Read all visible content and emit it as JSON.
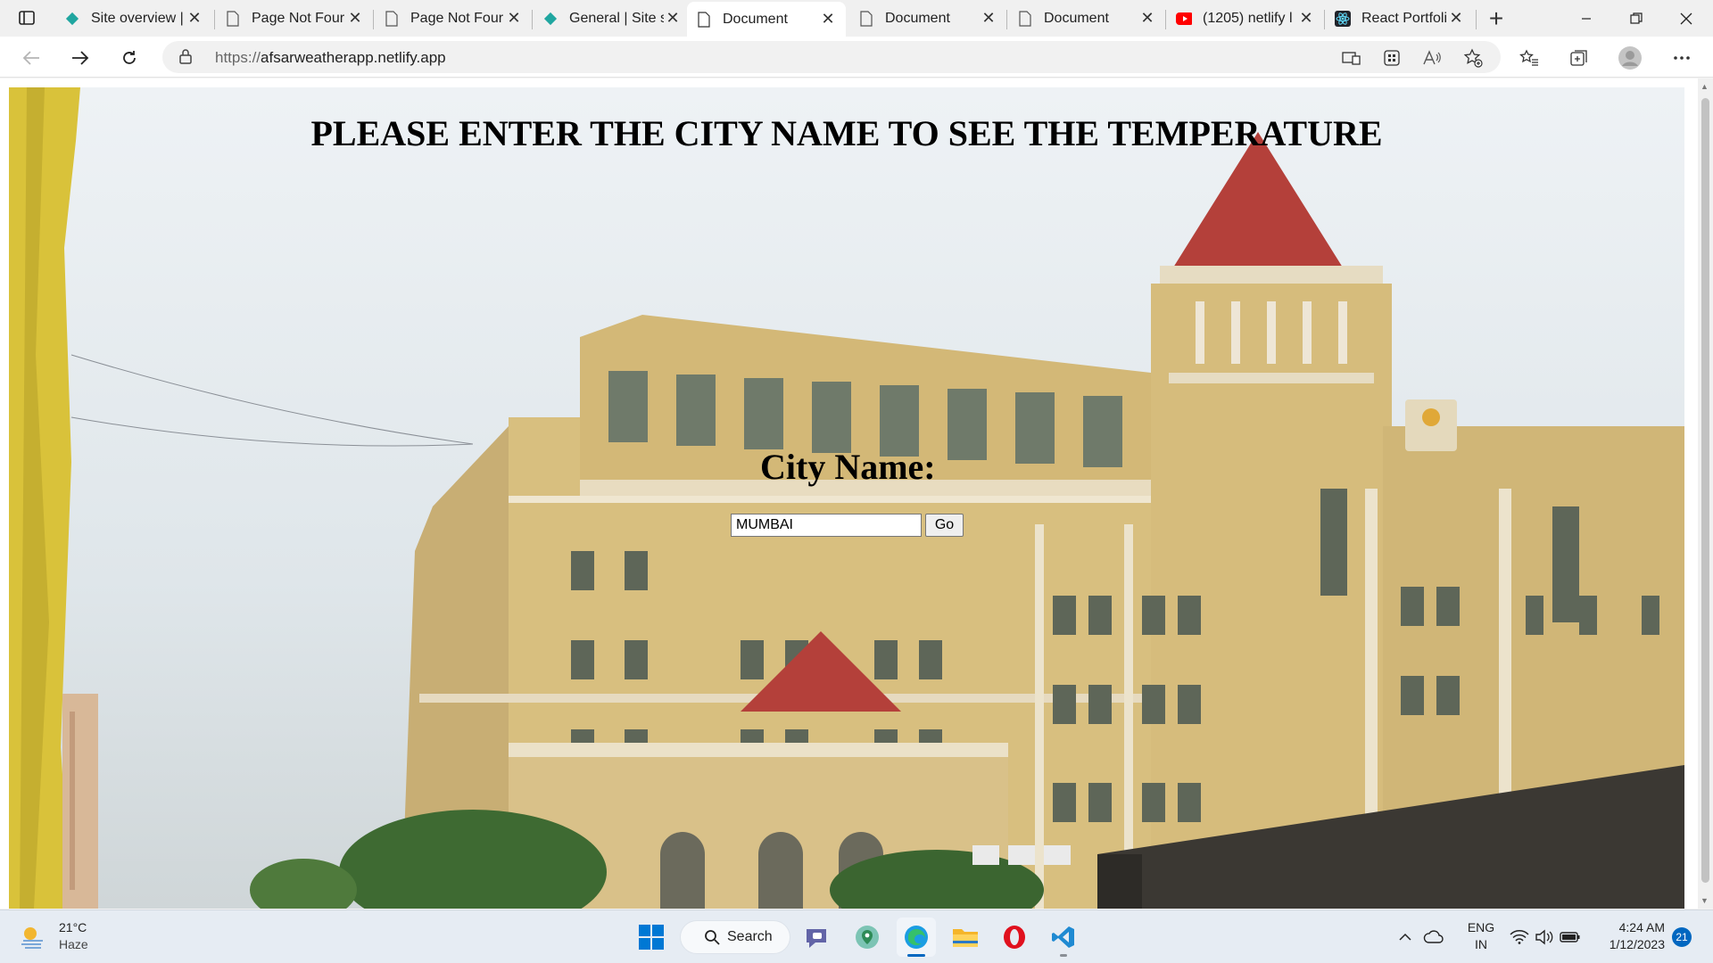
{
  "browser": {
    "tabs": [
      {
        "title": "Site overview |",
        "icon": "netlify-diamond-icon",
        "active": false
      },
      {
        "title": "Page Not Four",
        "icon": "page-icon",
        "active": false
      },
      {
        "title": "Page Not Four",
        "icon": "page-icon",
        "active": false
      },
      {
        "title": "General | Site s",
        "icon": "netlify-diamond-icon",
        "active": false
      },
      {
        "title": "Document",
        "icon": "page-icon",
        "active": true
      },
      {
        "title": "Document",
        "icon": "page-icon",
        "active": false
      },
      {
        "title": "Document",
        "icon": "page-icon",
        "active": false
      },
      {
        "title": "(1205) netlify l",
        "icon": "youtube-icon",
        "active": false
      },
      {
        "title": "React Portfolic",
        "icon": "react-icon",
        "active": false
      }
    ],
    "address": {
      "scheme": "https://",
      "host": "afsarweatherapp.netlify.app"
    }
  },
  "page": {
    "headline": "PLEASE ENTER THE CITY NAME TO SEE THE TEMPERATURE",
    "city_label": "City Name:",
    "city_input_value": "MUMBAI",
    "go_label": "Go"
  },
  "taskbar": {
    "weather": {
      "temp": "21°C",
      "condition": "Haze"
    },
    "search_label": "Search",
    "language": {
      "line1": "ENG",
      "line2": "IN"
    },
    "clock": {
      "time": "4:24 AM",
      "date": "1/12/2023"
    },
    "notification_count": "21"
  },
  "colors": {
    "accent": "#0067c0",
    "netlify": "#20a6a0",
    "youtube": "#ff0000",
    "building_wall": "#d8bf7f",
    "roof": "#b4403a"
  }
}
